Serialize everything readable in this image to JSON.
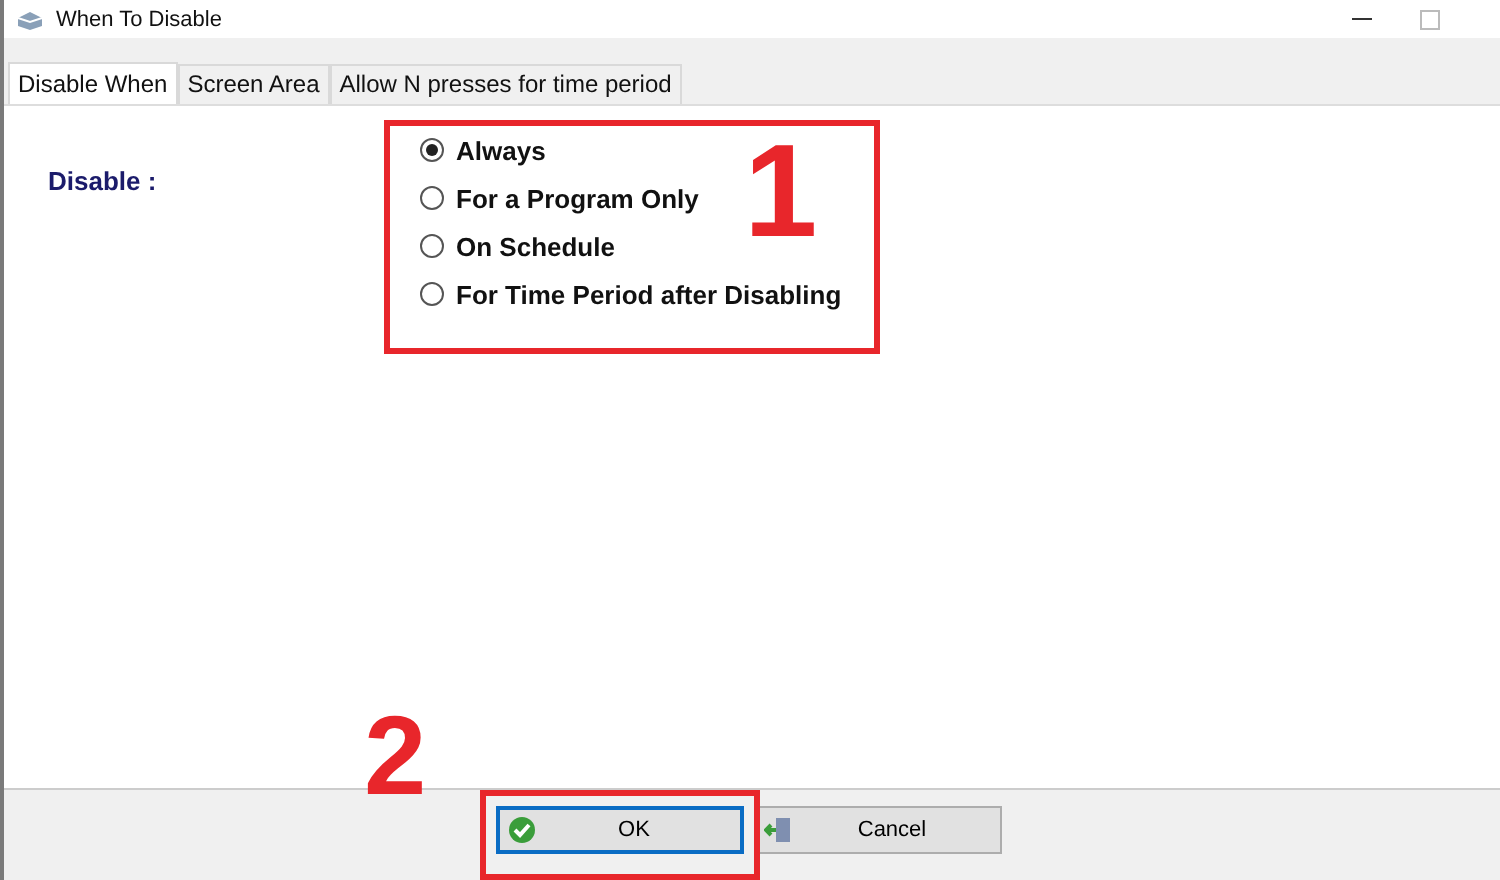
{
  "window": {
    "title": "When To Disable"
  },
  "tabs": [
    {
      "label": "Disable When",
      "selected": true
    },
    {
      "label": "Screen Area",
      "selected": false
    },
    {
      "label": "Allow N presses for time period",
      "selected": false
    }
  ],
  "disable_label": "Disable :",
  "options": [
    {
      "label": "Always",
      "selected": true
    },
    {
      "label": "For a Program Only",
      "selected": false
    },
    {
      "label": "On Schedule",
      "selected": false
    },
    {
      "label": "For Time Period after Disabling",
      "selected": false
    }
  ],
  "buttons": [
    {
      "label": "OK",
      "kind": "ok",
      "focused": true
    },
    {
      "label": "Cancel",
      "kind": "cancel",
      "focused": false
    }
  ],
  "annotations": [
    {
      "number": "1",
      "kind": "options"
    },
    {
      "number": "2",
      "kind": "ok"
    }
  ]
}
